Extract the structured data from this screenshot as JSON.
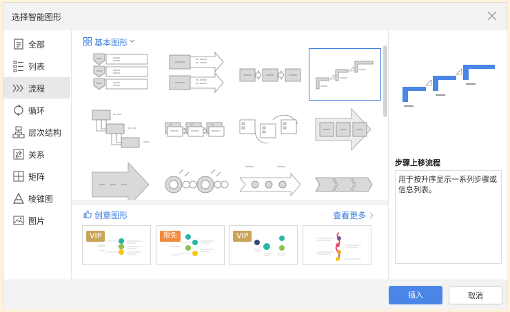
{
  "dialog": {
    "title": "选择智能图形"
  },
  "sidebar": {
    "items": [
      {
        "label": "全部",
        "icon": "all-icon"
      },
      {
        "label": "列表",
        "icon": "list-icon"
      },
      {
        "label": "流程",
        "icon": "process-icon",
        "active": true
      },
      {
        "label": "循环",
        "icon": "cycle-icon"
      },
      {
        "label": "层次结构",
        "icon": "hierarchy-icon"
      },
      {
        "label": "关系",
        "icon": "relationship-icon"
      },
      {
        "label": "矩阵",
        "icon": "matrix-icon"
      },
      {
        "label": "棱锥图",
        "icon": "pyramid-icon"
      },
      {
        "label": "图片",
        "icon": "picture-icon"
      }
    ]
  },
  "main": {
    "basic_title": "基本图形",
    "creative_title": "创意图形",
    "more_label": "查看更多",
    "creative_cards": [
      {
        "badge": "VIP",
        "badge_color": "#c9a55a"
      },
      {
        "badge": "限免",
        "badge_color": "#f08a3c"
      },
      {
        "badge": "VIP",
        "badge_color": "#c9a55a"
      },
      {
        "badge": "",
        "badge_color": ""
      }
    ]
  },
  "preview": {
    "name": "步骤上移流程",
    "description": "用于按升序显示一系列步骤或信息列表。",
    "accent": "#4a86e6"
  },
  "footer": {
    "insert": "插入",
    "cancel": "取消"
  }
}
